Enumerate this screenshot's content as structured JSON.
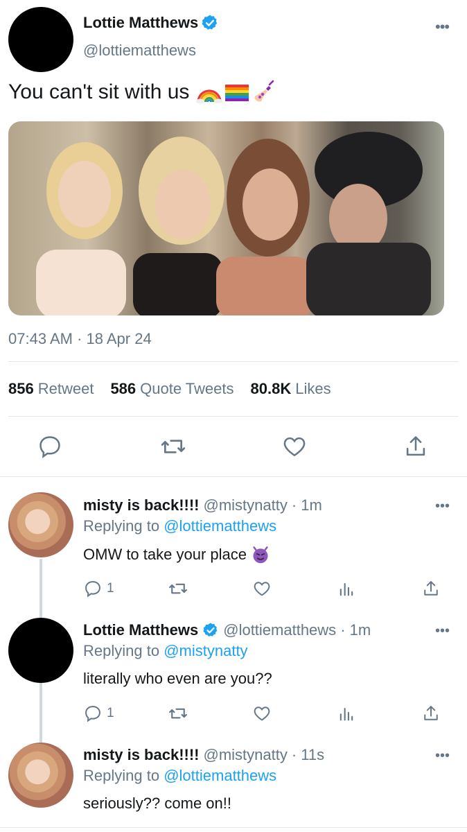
{
  "tweet": {
    "author_name": "Lottie Matthews",
    "author_handle": "@lottiematthews",
    "text": "You can't sit with us",
    "emojis": [
      "rainbow",
      "rainbow-flag",
      "nail-polish"
    ],
    "timestamp": "07:43 AM · 18 Apr 24",
    "stats": {
      "retweets": {
        "count": "856",
        "label": "Retweet"
      },
      "quotes": {
        "count": "586",
        "label": "Quote Tweets"
      },
      "likes": {
        "count": "80.8K",
        "label": "Likes"
      }
    },
    "actions": [
      "reply-icon",
      "retweet-icon",
      "like-icon",
      "share-icon"
    ]
  },
  "replies": [
    {
      "name": "misty is back!!!!",
      "handle": "@mistynatty",
      "time": "· 1m",
      "replying_label": "Replying to",
      "replying_to": "@lottiematthews",
      "text": "OMW to take your place",
      "emoji": "smiling-imp",
      "reply_count": "1",
      "verified": false
    },
    {
      "name": "Lottie Matthews",
      "handle": "@lottiematthews",
      "time": "· 1m",
      "replying_label": "Replying to",
      "replying_to": "@mistynatty",
      "text": "literally who even are you??",
      "reply_count": "1",
      "verified": true
    },
    {
      "name": "misty is back!!!!",
      "handle": "@mistynatty",
      "time": "· 11s",
      "replying_label": "Replying to",
      "replying_to": "@lottiematthews",
      "text": "seriously?? come on!!",
      "verified": false
    }
  ],
  "colors": {
    "accent": "#1da1f2",
    "muted": "#657786",
    "text": "#14171a",
    "divider": "#e1e8ed",
    "emoji_purple": "#8e57b8"
  }
}
